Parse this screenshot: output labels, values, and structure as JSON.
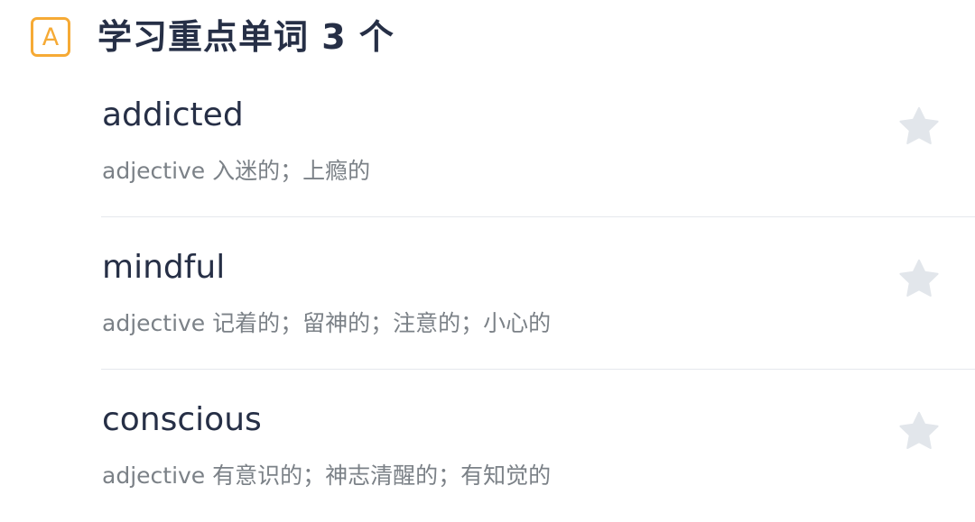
{
  "section": {
    "badge_letter": "A",
    "title": "学习重点单词 3 个"
  },
  "words": [
    {
      "word": "addicted",
      "meaning": "adjective 入迷的；上瘾的",
      "starred": false
    },
    {
      "word": "mindful",
      "meaning": "adjective 记着的；留神的；注意的；小心的",
      "starred": false
    },
    {
      "word": "conscious",
      "meaning": "adjective 有意识的；神志清醒的；有知觉的",
      "starred": false
    }
  ],
  "icons": {
    "section_badge": "letter-a-badge-icon",
    "favorite": "star-icon"
  },
  "colors": {
    "badge_accent": "#f6aa35",
    "title_text": "#262f46",
    "meaning_text": "#7b8187",
    "star_inactive": "#e2e6eb",
    "divider": "#e5e8ed"
  }
}
